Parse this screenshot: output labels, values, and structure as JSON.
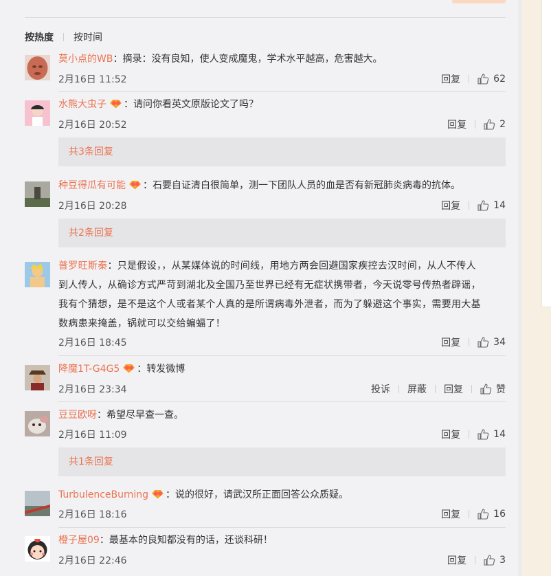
{
  "sort": {
    "hot": "按热度",
    "time": "按时间"
  },
  "comments": [
    {
      "user": "莫小点的WB",
      "vip": false,
      "text": "：摘录：没有良知，使人变成魔鬼，学术水平越高，危害越大。",
      "time": "2月16日 11:52",
      "reply": "回复",
      "likes": "62"
    },
    {
      "user": "水熊大虫子",
      "vip": true,
      "text": "：请问你看英文原版论文了吗？",
      "time": "2月16日 20:52",
      "reply": "回复",
      "likes": "2",
      "replies": "共3条回复"
    },
    {
      "user": "种豆得瓜有可能",
      "vip": true,
      "text": "：石要自证清白很简单，测一下团队人员的血是否有新冠肺炎病毒的抗体。",
      "time": "2月16日 20:28",
      "reply": "回复",
      "likes": "14",
      "replies": "共2条回复"
    },
    {
      "user": "普罗旺斯秦",
      "vip": false,
      "text_lines": [
        "：只是假设，，从某媒体说的时间线，用地方两会回避国家疾控去汉时间，从人不传人",
        "到人传人，从确诊方式严苛到湖北及全国乃至世界已经有无症状携带者，今天说零号传热者辟谣，",
        "我有个猜想，是不是这个人或者某个人真的是所谓病毒外泄者，而为了躲避这个事实，需要用大基",
        "数病患来掩盖，锅就可以交给蝙蝠了！"
      ],
      "time": "2月16日 18:45",
      "reply": "回复",
      "likes": "34"
    },
    {
      "user": "降魔1T-G4G5",
      "vip": true,
      "text": "：转发微博",
      "time": "2月16日 23:34",
      "report": "投诉",
      "block": "屏蔽",
      "reply": "回复",
      "likes": "赞"
    },
    {
      "user": "豆豆欧呀",
      "vip": false,
      "text": "：希望尽早查一查。",
      "time": "2月16日 11:09",
      "reply": "回复",
      "likes": "14",
      "replies": "共1条回复"
    },
    {
      "user": "TurbulenceBurning",
      "vip": true,
      "text": "：说的很好，请武汉所正面回答公众质疑。",
      "time": "2月16日 18:16",
      "reply": "回复",
      "likes": "16"
    },
    {
      "user": "橙子屋09",
      "vip": false,
      "text": "：最基本的良知都没有的话，还谈科研！",
      "time": "2月16日 22:46",
      "reply": "回复",
      "likes": "3"
    }
  ]
}
